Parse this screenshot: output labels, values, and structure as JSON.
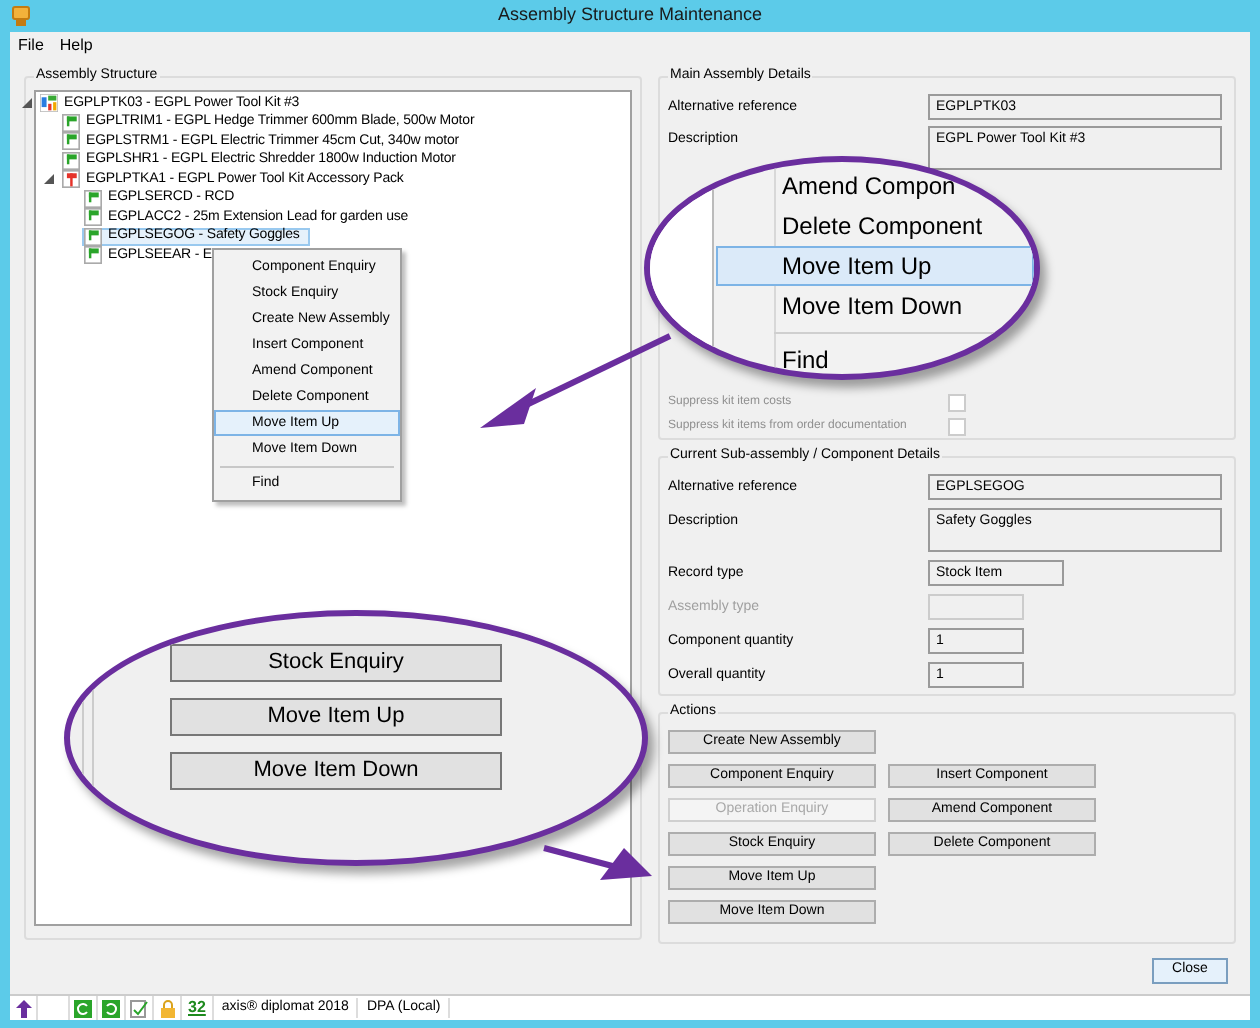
{
  "window": {
    "title": "Assembly Structure Maintenance"
  },
  "menu": [
    "File",
    "Help"
  ],
  "assembly_structure": {
    "title": "Assembly Structure",
    "tree": [
      {
        "label": "EGPLPTK03 - EGPL Power Tool Kit #3",
        "kind": "kit",
        "selected": false,
        "expanded": true,
        "children": [
          {
            "label": "EGPLTRIM1 - EGPL Hedge Trimmer 600mm Blade, 500w Motor",
            "kind": "item",
            "selected": false
          },
          {
            "label": "EGPLSTRM1 - EGPL Electric Trimmer 45cm Cut, 340w motor",
            "kind": "item",
            "selected": false
          },
          {
            "label": "EGPLSHR1 - EGPL Electric Shredder 1800w Induction Motor",
            "kind": "item",
            "selected": false
          },
          {
            "label": "EGPLPTKA1 - EGPL Power Tool Kit Accessory Pack",
            "kind": "subassembly",
            "selected": false,
            "expanded": true,
            "children": [
              {
                "label": "EGPLSERCD - RCD",
                "kind": "item",
                "selected": false
              },
              {
                "label": "EGPLACC2 - 25m Extension Lead for garden use",
                "kind": "item",
                "selected": false
              },
              {
                "label": "EGPLSEGOG - Safety Goggles",
                "kind": "item",
                "selected": true
              },
              {
                "label": "EGPLSEEAR - E",
                "kind": "item",
                "selected": false
              }
            ]
          }
        ]
      }
    ]
  },
  "context_menu": {
    "items": [
      {
        "label": "Component Enquiry",
        "selected": false,
        "separator_before": false
      },
      {
        "label": "Stock Enquiry",
        "selected": false,
        "separator_before": false
      },
      {
        "label": "Create New Assembly",
        "selected": false,
        "separator_before": false
      },
      {
        "label": "Insert Component",
        "selected": false,
        "separator_before": false
      },
      {
        "label": "Amend Component",
        "selected": false,
        "separator_before": false
      },
      {
        "label": "Delete Component",
        "selected": false,
        "separator_before": false
      },
      {
        "label": "Move Item Up",
        "selected": true,
        "separator_before": false
      },
      {
        "label": "Move Item Down",
        "selected": false,
        "separator_before": false
      },
      {
        "label": "Find",
        "selected": false,
        "separator_before": true
      }
    ]
  },
  "main_details": {
    "title": "Main Assembly Details",
    "fields": [
      {
        "label": "Alternative reference",
        "value": "EGPLPTK03",
        "kind": "text",
        "disabled": false
      },
      {
        "label": "Description",
        "value": "EGPL Power Tool Kit #3",
        "kind": "multiline",
        "disabled": false
      }
    ],
    "options": [
      {
        "label": "Suppress kit item costs",
        "checked": false,
        "disabled": true
      },
      {
        "label": "Suppress kit items from order documentation",
        "checked": false,
        "disabled": true
      }
    ]
  },
  "component_details": {
    "title": "Current Sub-assembly / Component Details",
    "fields": [
      {
        "label": "Alternative reference",
        "value": "EGPLSEGOG",
        "kind": "text",
        "disabled": false
      },
      {
        "label": "Description",
        "value": "Safety Goggles",
        "kind": "multiline",
        "disabled": false
      },
      {
        "label": "Record type",
        "value": "Stock Item",
        "kind": "medium",
        "disabled": false
      },
      {
        "label": "Assembly type",
        "kind": "short",
        "disabled": true
      },
      {
        "label": "Component quantity",
        "value": "1",
        "kind": "short",
        "disabled": false
      },
      {
        "label": "Overall quantity",
        "value": "1",
        "kind": "short",
        "disabled": false
      }
    ]
  },
  "actions": {
    "title": "Actions",
    "rows": [
      [
        {
          "label": "Create New Assembly",
          "disabled": false
        }
      ],
      [
        {
          "label": "Component Enquiry",
          "disabled": false
        },
        {
          "label": "Insert Component",
          "disabled": false
        }
      ],
      [
        {
          "label": "Operation Enquiry",
          "disabled": true
        },
        {
          "label": "Amend Component",
          "disabled": false
        }
      ],
      [
        {
          "label": "Stock Enquiry",
          "disabled": false
        },
        {
          "label": "Delete Component",
          "disabled": false
        }
      ],
      [
        {
          "label": "Move Item Up",
          "disabled": false
        }
      ],
      [
        {
          "label": "Move Item Down",
          "disabled": false
        }
      ]
    ]
  },
  "close_button": "Close",
  "status_bar": {
    "count": "32",
    "product": "axis® diplomat 2018",
    "database": "DPA (Local)"
  },
  "callouts": [
    {
      "kind": "menu",
      "items": [
        {
          "label": "Amend Compon",
          "selected": false
        },
        {
          "label": "Delete Component",
          "selected": false
        },
        {
          "label": "Move Item Up",
          "selected": true
        },
        {
          "label": "Move Item Down",
          "selected": false
        },
        {
          "label": "Find",
          "selected": false
        }
      ]
    },
    {
      "kind": "buttons",
      "items": [
        {
          "label": "Stock Enquiry"
        },
        {
          "label": "Move Item Up"
        },
        {
          "label": "Move Item Down"
        }
      ]
    }
  ]
}
